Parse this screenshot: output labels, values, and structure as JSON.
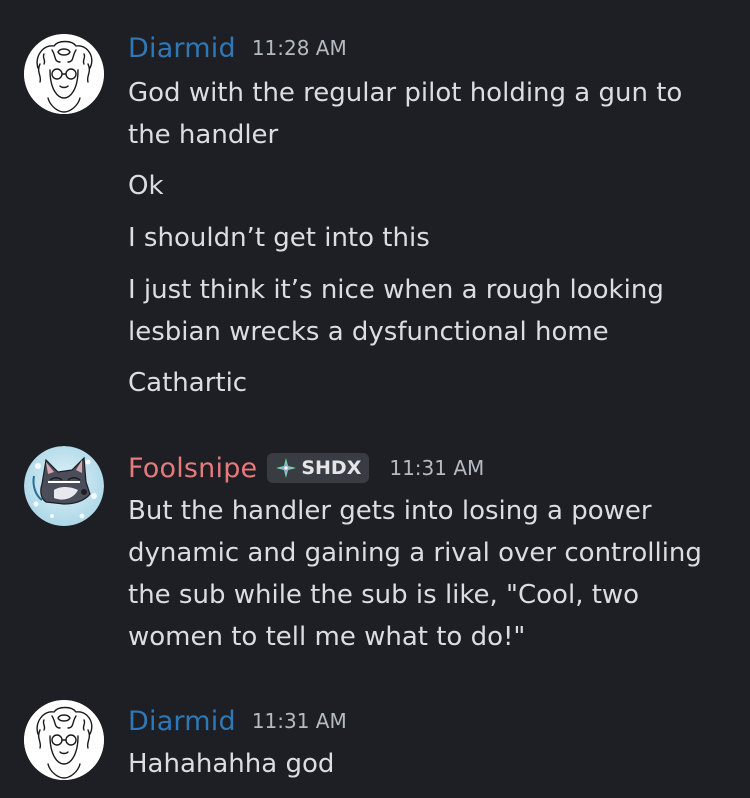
{
  "messages": [
    {
      "author": "Diarmid",
      "author_color": "#2e78b7",
      "time": "11:28 AM",
      "avatar": "sketch-portrait-icon",
      "lines": [
        "God with the regular pilot holding a gun to the handler",
        "Ok",
        "I shouldn’t get into this",
        "I just think it’s nice when a rough looking lesbian wrecks a dysfunctional home",
        "Cathartic"
      ]
    },
    {
      "author": "Foolsnipe",
      "author_color": "#e47a7a",
      "tag": "SHDX",
      "tag_icon": "sparkle-icon",
      "time": "11:31 AM",
      "avatar": "wolf-portrait-icon",
      "lines": [
        "But the handler gets into losing a power dynamic and gaining a rival over controlling the sub while the sub is like, \"Cool, two women to tell me what to do!\""
      ]
    },
    {
      "author": "Diarmid",
      "author_color": "#2e78b7",
      "time": "11:31 AM",
      "avatar": "sketch-portrait-icon",
      "lines": [
        "Hahahahha god"
      ]
    }
  ]
}
